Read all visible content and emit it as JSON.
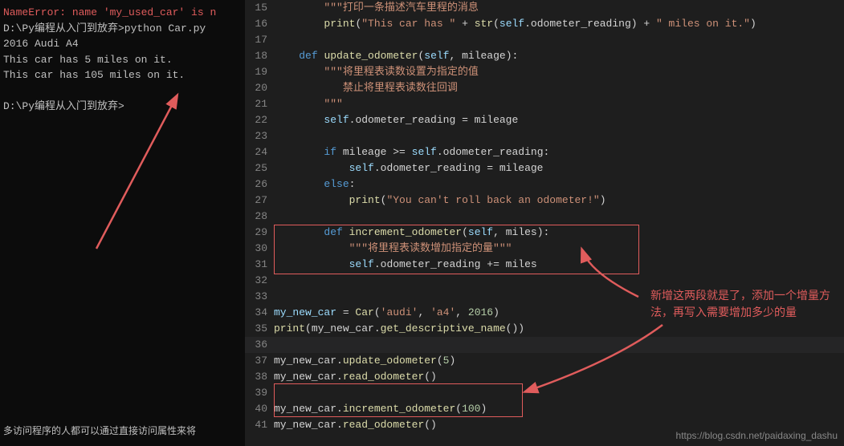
{
  "terminal": {
    "lines": [
      {
        "text": "NameError: name 'my_used_car' is n",
        "class": "term-error"
      },
      {
        "text": "D:\\Py编程从入门到放弃>python Car.py",
        "class": "term-path"
      },
      {
        "text": "2016 Audi A4",
        "class": "term-normal"
      },
      {
        "text": "This car has 5 miles on it.",
        "class": "term-normal"
      },
      {
        "text": "This car has 105 miles on it.",
        "class": "term-normal"
      },
      {
        "text": "",
        "class": "term-normal"
      },
      {
        "text": "D:\\Py编程从入门到放弃>",
        "class": "term-prompt"
      }
    ],
    "bottom_text": "多访问程序的人都可以通过直接访问属性来将"
  },
  "code": {
    "lines": [
      {
        "num": 15,
        "content": "        \"\"\"打印一条描述汽车里程的消息"
      },
      {
        "num": 16,
        "content": "        print(\"This car has \" + str(self.odometer_reading) + \" miles on it.\")"
      },
      {
        "num": 17,
        "content": ""
      },
      {
        "num": 18,
        "content": "    def update_odometer(self, mileage):"
      },
      {
        "num": 19,
        "content": "        \"\"\"将里程表读数设置为指定的值"
      },
      {
        "num": 20,
        "content": "           禁止将里程表读数往回调"
      },
      {
        "num": 21,
        "content": "        \"\"\""
      },
      {
        "num": 22,
        "content": "        self.odometer_reading = mileage"
      },
      {
        "num": 23,
        "content": ""
      },
      {
        "num": 24,
        "content": "        if mileage >= self.odometer_reading:"
      },
      {
        "num": 25,
        "content": "            self.odometer_reading = mileage"
      },
      {
        "num": 26,
        "content": "        else:"
      },
      {
        "num": 27,
        "content": "            print(\"You can't roll back an odometer!\")"
      },
      {
        "num": 28,
        "content": ""
      },
      {
        "num": 29,
        "content": "        def increment_odometer(self, miles):"
      },
      {
        "num": 30,
        "content": "            \"\"\"将里程表读数增加指定的量\"\"\""
      },
      {
        "num": 31,
        "content": "            self.odometer_reading += miles"
      },
      {
        "num": 32,
        "content": ""
      },
      {
        "num": 33,
        "content": ""
      },
      {
        "num": 34,
        "content": "my_new_car = Car('audi', 'a4', 2016)"
      },
      {
        "num": 35,
        "content": "print(my_new_car.get_descriptive_name())"
      },
      {
        "num": 36,
        "content": ""
      },
      {
        "num": 37,
        "content": "my_new_car.update_odometer(5)"
      },
      {
        "num": 38,
        "content": "my_new_car.read_odometer()"
      },
      {
        "num": 39,
        "content": ""
      },
      {
        "num": 40,
        "content": "my_new_car.increment_odometer(100)"
      },
      {
        "num": 41,
        "content": "my_new_car.read_odometer()"
      }
    ],
    "annotation": "新增这两段就是了，添加一个增量方\n法，再写入需要增加多少的量"
  },
  "watermark": "https://blog.csdn.net/paidaxing_dashu"
}
